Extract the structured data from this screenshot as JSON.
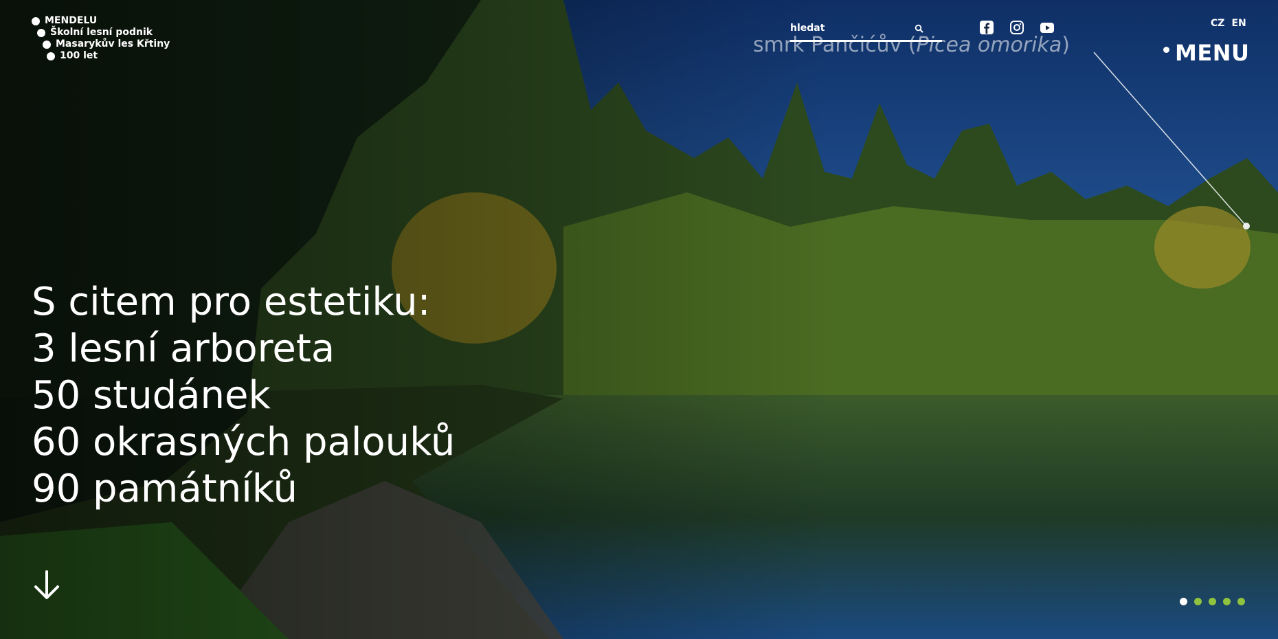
{
  "breadcrumb": [
    "MENDELU",
    "Školní lesní podnik",
    "Masarykův les Křtiny",
    "100 let"
  ],
  "search": {
    "placeholder": "hledat",
    "icon": "search-icon"
  },
  "social": [
    "facebook-icon",
    "instagram-icon",
    "youtube-icon"
  ],
  "languages": [
    "CZ",
    "EN"
  ],
  "menu": {
    "label": "MENU"
  },
  "photo_caption": {
    "common_name": "smrk Pančićův",
    "latin_name": "Picea omorika"
  },
  "headline": [
    "S citem pro estetiku:",
    "3 lesní arboreta",
    "50 studánek",
    "60 okrasných palouků",
    "90 památníků"
  ],
  "scroll_icon": "arrow-down-icon",
  "slider": {
    "count": 5,
    "active_index": 0
  },
  "colors": {
    "text": "#ffffff",
    "pager_active": "#ffffff",
    "pager_inactive": "#8fc33f",
    "sky": "#1e4f8c",
    "water": "#1a4a80"
  }
}
